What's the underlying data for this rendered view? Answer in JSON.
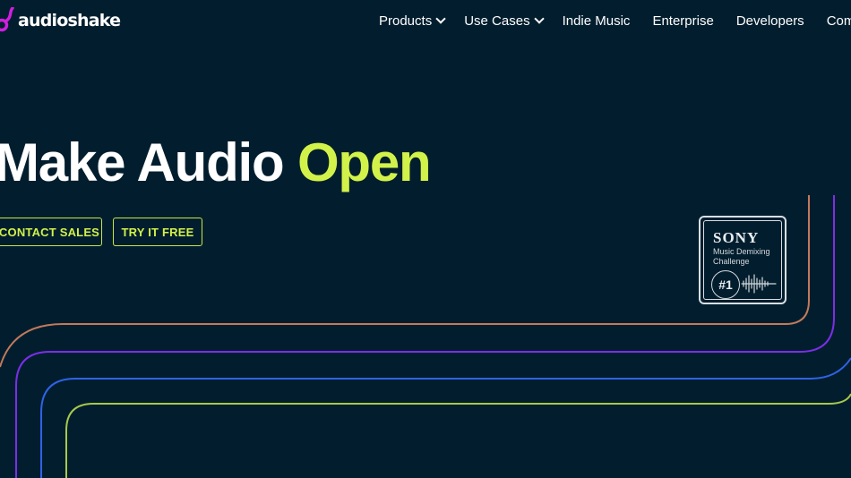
{
  "brand": {
    "name": "audioshake",
    "logo_color": "#d11ee0"
  },
  "nav": {
    "items": [
      {
        "label": "Products",
        "has_dropdown": true,
        "icon": "chevron-down-icon"
      },
      {
        "label": "Use Cases",
        "has_dropdown": true,
        "icon": "chevron-down-icon"
      },
      {
        "label": "Indie Music",
        "has_dropdown": false
      },
      {
        "label": "Enterprise",
        "has_dropdown": false
      },
      {
        "label": "Developers",
        "has_dropdown": false
      },
      {
        "label": "Company",
        "has_dropdown": false
      }
    ]
  },
  "hero": {
    "title_part1": "Make Audio ",
    "title_accent": "Open",
    "cta_primary": "CONTACT SALES",
    "cta_secondary": "TRY IT FREE"
  },
  "badge": {
    "brand": "SONY",
    "line1": "Music Demixing",
    "line2": "Challenge",
    "rank": "#1",
    "icon": "waveform-icon"
  },
  "colors": {
    "background": "#021e2e",
    "accent": "#d2f24a",
    "line_orange": "#c27a5c",
    "line_purple": "#7c2ee8",
    "line_blue": "#2f63e6",
    "line_green": "#a7c94c"
  }
}
